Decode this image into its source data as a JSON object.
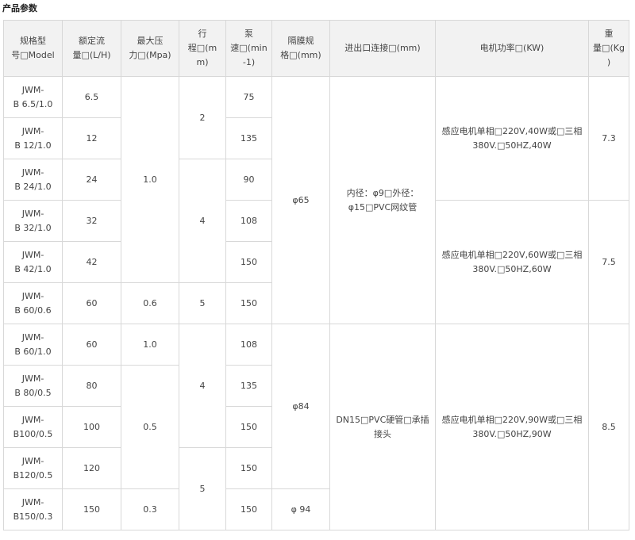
{
  "title": "产品参数",
  "headers": {
    "model": "规格型\n号□Model",
    "flow": "额定流\n量□(L/H)",
    "pressure": "最大压\n力□(Mpa)",
    "stroke": "行\n程□(m\nm)",
    "speed": "泵\n速□(min\n-1)",
    "diaphragm": "隔膜规\n格□(mm)",
    "connection": "进出口连接□(mm)",
    "motor": "电机功率□(KW)",
    "weight": "重\n量□(Kg\n)"
  },
  "rows": [
    {
      "model": "JWM-\nB 6.5/1.0",
      "flow": "6.5",
      "speed": "75"
    },
    {
      "model": "JWM-\nB 12/1.0",
      "flow": "12",
      "speed": "135"
    },
    {
      "model": "JWM-\nB 24/1.0",
      "flow": "24",
      "speed": "90"
    },
    {
      "model": "JWM-\nB 32/1.0",
      "flow": "32",
      "speed": "108"
    },
    {
      "model": "JWM-\nB 42/1.0",
      "flow": "42",
      "speed": "150"
    },
    {
      "model": "JWM-\nB 60/0.6",
      "flow": "60",
      "speed": "150"
    },
    {
      "model": "JWM-\nB 60/1.0",
      "flow": "60",
      "speed": "108"
    },
    {
      "model": "JWM-\nB 80/0.5",
      "flow": "80",
      "speed": "135"
    },
    {
      "model": "JWM-\nB100/0.5",
      "flow": "100",
      "speed": "150"
    },
    {
      "model": "JWM-\nB120/0.5",
      "flow": "120",
      "speed": "150"
    },
    {
      "model": "JWM-\nB150/0.3",
      "flow": "150",
      "speed": "150"
    }
  ],
  "merged": {
    "pressure_1": "1.0",
    "pressure_2": "0.6",
    "pressure_3": "1.0",
    "pressure_4": "0.5",
    "pressure_5": "0.3",
    "stroke_1": "2",
    "stroke_2": "4",
    "stroke_3": "5",
    "stroke_4": "4",
    "stroke_5": "5",
    "diaphragm_1": "φ65",
    "diaphragm_2": "φ84",
    "diaphragm_3": "φ 94",
    "connection_1": "内径：φ9□外径：\nφ15□PVC网纹管",
    "connection_2": "DN15□PVC硬管□承插\n接头",
    "motor_1": "感应电机单相□220V,40W或□三相\n380V.□50HZ,40W",
    "motor_2": "感应电机单相□220V,60W或□三相\n380V.□50HZ,60W",
    "motor_3": "感应电机单相□220V,90W或□三相\n380V.□50HZ,90W",
    "weight_1": "7.3",
    "weight_2": "7.5",
    "weight_3": "8.5"
  }
}
